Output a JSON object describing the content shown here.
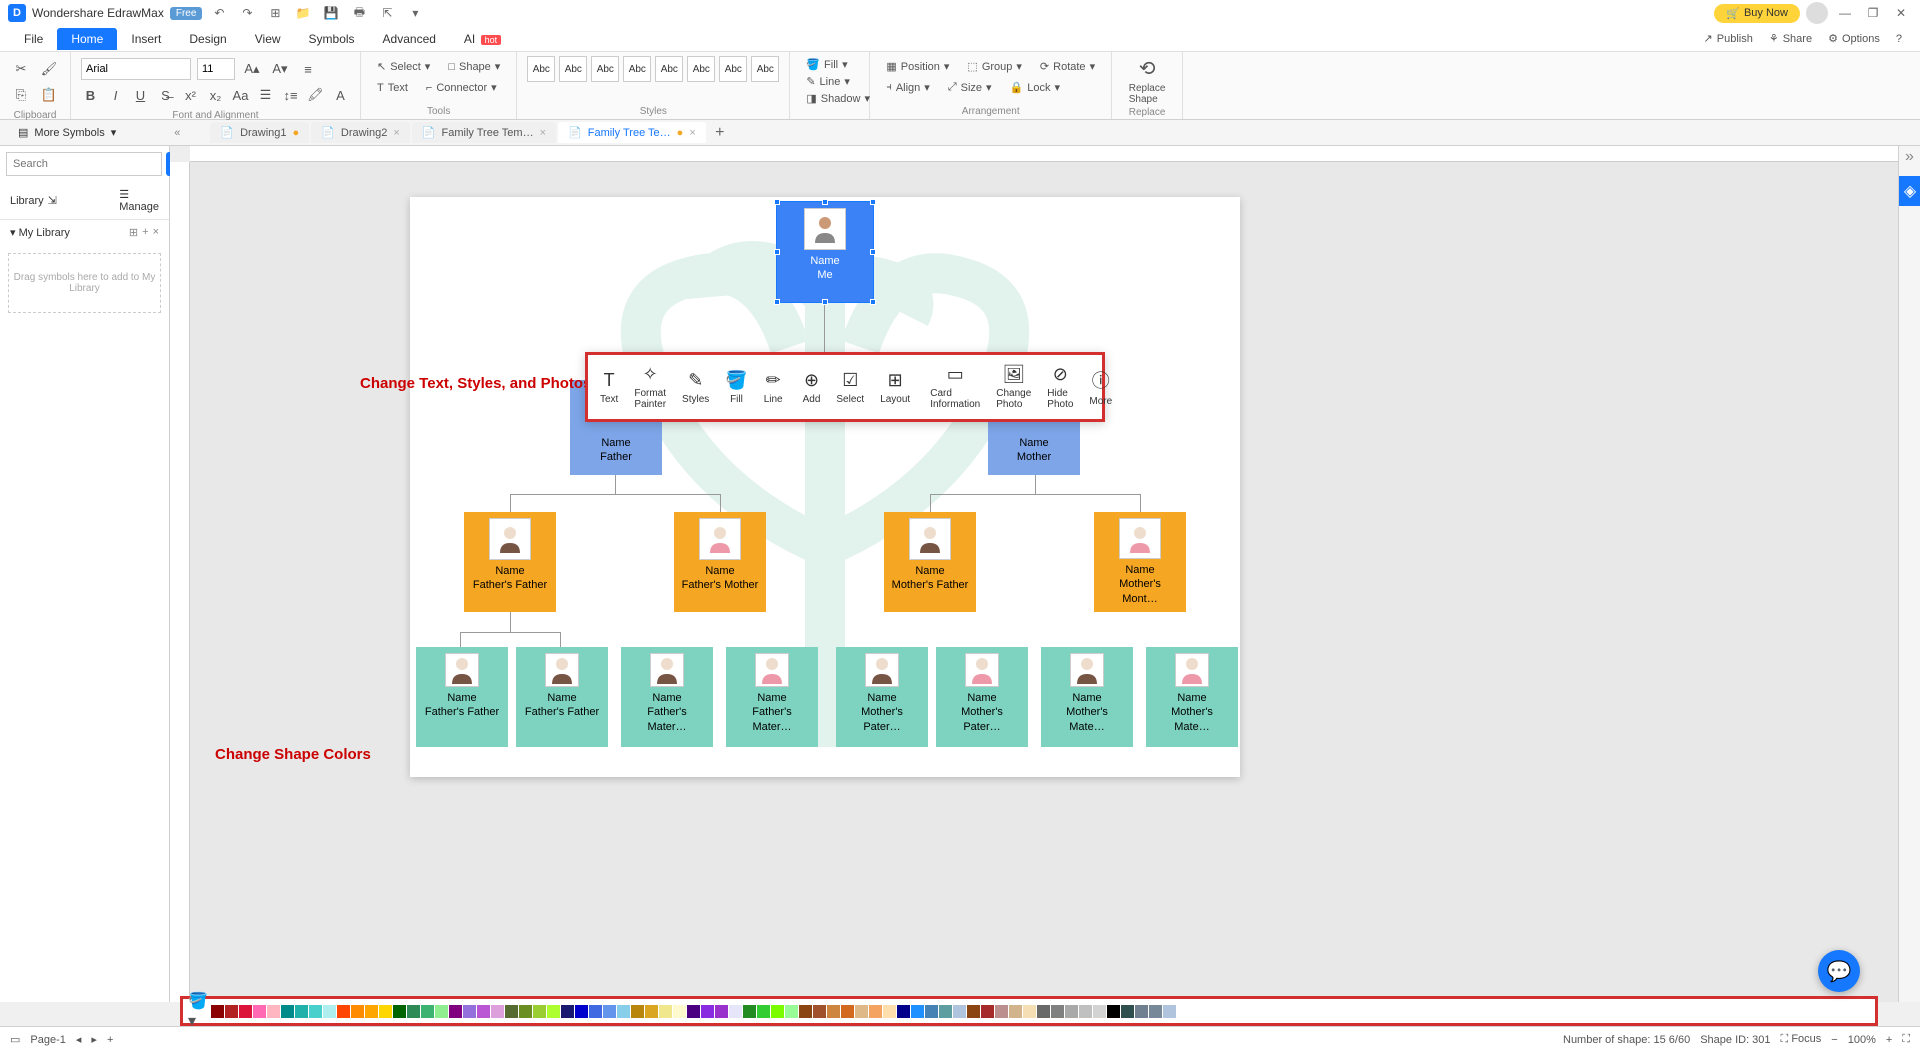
{
  "app": {
    "name": "Wondershare EdrawMax",
    "badge": "Free"
  },
  "title_actions": {
    "buy_now": "Buy Now"
  },
  "menu": {
    "items": [
      "File",
      "Home",
      "Insert",
      "Design",
      "View",
      "Symbols",
      "Advanced",
      "AI"
    ],
    "hot": "hot",
    "active_index": 1,
    "right": {
      "publish": "Publish",
      "share": "Share",
      "options": "Options"
    }
  },
  "ribbon": {
    "clipboard": {
      "label": "Clipboard"
    },
    "font": {
      "label": "Font and Alignment",
      "name": "Arial",
      "size": "11"
    },
    "tools": {
      "label": "Tools",
      "select": "Select",
      "text": "Text",
      "shape": "Shape",
      "connector": "Connector"
    },
    "styles_label": "Styles",
    "style_swatches": [
      "Abc",
      "Abc",
      "Abc",
      "Abc",
      "Abc",
      "Abc",
      "Abc",
      "Abc"
    ],
    "fill": "Fill",
    "line": "Line",
    "shadow": "Shadow",
    "arrangement": {
      "label": "Arrangement",
      "position": "Position",
      "align": "Align",
      "group": "Group",
      "size": "Size",
      "rotate": "Rotate",
      "lock": "Lock"
    },
    "replace": {
      "label": "Replace",
      "shape": "Replace\nShape"
    }
  },
  "tool_shelf": {
    "more_symbols": "More Symbols"
  },
  "tabs": [
    {
      "label": "Drawing1",
      "modified": true,
      "active": false
    },
    {
      "label": "Drawing2",
      "modified": false,
      "active": false
    },
    {
      "label": "Family Tree Tem…",
      "modified": false,
      "active": false
    },
    {
      "label": "Family Tree Te…",
      "modified": true,
      "active": true
    }
  ],
  "sidebar": {
    "search_placeholder": "Search",
    "search_btn": "Search",
    "library": "Library",
    "manage": "Manage",
    "my_library": "My Library",
    "drop_hint": "Drag symbols here to add to My Library"
  },
  "annotations": {
    "toolbar": "Change Text, Styles, and Photos",
    "colors": "Change Shape Colors"
  },
  "float_toolbar": [
    "Text",
    "Format Painter",
    "Styles",
    "Fill",
    "Line",
    "Add",
    "Select",
    "Layout",
    "Card Information",
    "Change Photo",
    "Hide Photo",
    "More"
  ],
  "tree": {
    "me": {
      "name": "Name",
      "role": "Me"
    },
    "father": {
      "name": "Name",
      "role": "Father"
    },
    "mother": {
      "name": "Name",
      "role": "Mother"
    },
    "gp": [
      {
        "name": "Name",
        "role": "Father's Father"
      },
      {
        "name": "Name",
        "role": "Father's Mother"
      },
      {
        "name": "Name",
        "role": "Mother's Father"
      },
      {
        "name": "Name",
        "role": "Mother's Mont…"
      }
    ],
    "ggp": [
      {
        "name": "Name",
        "role": "Father's Father"
      },
      {
        "name": "Name",
        "role": "Father's Father"
      },
      {
        "name": "Name",
        "role": "Father's Mater…"
      },
      {
        "name": "Name",
        "role": "Father's Mater…"
      },
      {
        "name": "Name",
        "role": "Mother's Pater…"
      },
      {
        "name": "Name",
        "role": "Mother's Pater…"
      },
      {
        "name": "Name",
        "role": "Mother's Mate…"
      },
      {
        "name": "Name",
        "role": "Mother's Mate…"
      }
    ]
  },
  "palette": [
    "#8B0000",
    "#B22222",
    "#DC143C",
    "#FF69B4",
    "#FFB6C1",
    "#008B8B",
    "#20B2AA",
    "#48D1CC",
    "#AFEEEE",
    "#FF4500",
    "#FF8C00",
    "#FFA500",
    "#FFD700",
    "#006400",
    "#2E8B57",
    "#3CB371",
    "#90EE90",
    "#800080",
    "#9370DB",
    "#BA55D3",
    "#DDA0DD",
    "#556B2F",
    "#6B8E23",
    "#9ACD32",
    "#ADFF2F",
    "#191970",
    "#0000CD",
    "#4169E1",
    "#6495ED",
    "#87CEEB",
    "#B8860B",
    "#DAA520",
    "#F0E68C",
    "#FFFACD",
    "#4B0082",
    "#8A2BE2",
    "#9932CC",
    "#E6E6FA",
    "#228B22",
    "#32CD32",
    "#7CFC00",
    "#98FB98",
    "#8B4513",
    "#A0522D",
    "#CD853F",
    "#D2691E",
    "#DEB887",
    "#F4A460",
    "#FFDEAD",
    "#00008B",
    "#1E90FF",
    "#4682B4",
    "#5F9EA0",
    "#B0C4DE",
    "#8B4513",
    "#A52A2A",
    "#BC8F8F",
    "#D2B48C",
    "#F5DEB3",
    "#696969",
    "#808080",
    "#A9A9A9",
    "#C0C0C0",
    "#D3D3D3",
    "#000000",
    "#2F4F4F",
    "#708090",
    "#778899",
    "#B0C4DE",
    "#FFFFFF"
  ],
  "status": {
    "page": "Page-1",
    "shapes": "Number of shape: 15 6/60",
    "shape_id": "Shape ID: 301",
    "focus": "Focus",
    "zoom": "100%"
  }
}
